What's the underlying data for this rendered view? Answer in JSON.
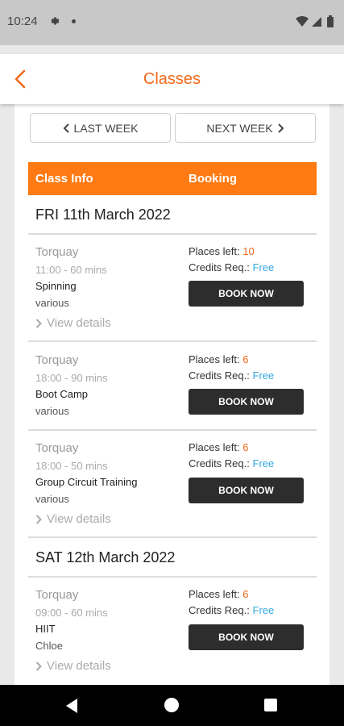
{
  "status_bar": {
    "time": "10:24"
  },
  "header": {
    "title": "Classes"
  },
  "week_nav": {
    "prev_label": "LAST WEEK",
    "next_label": "NEXT WEEK"
  },
  "table_header": {
    "info": "Class Info",
    "booking": "Booking"
  },
  "days": [
    {
      "heading": "FRI 11th March 2022",
      "classes": [
        {
          "location": "Torquay",
          "time": "11:00 - 60 mins",
          "name": "Spinning",
          "instructor": "various",
          "details": "View details",
          "places_label": "Places left:",
          "places": "10",
          "credits_label": "Credits Req.:",
          "credits": "Free",
          "book": "BOOK NOW"
        },
        {
          "location": "Torquay",
          "time": "18:00 - 90 mins",
          "name": "Boot Camp",
          "instructor": "various",
          "details": "",
          "places_label": "Places left:",
          "places": "6",
          "credits_label": "Credits Req.:",
          "credits": "Free",
          "book": "BOOK NOW"
        },
        {
          "location": "Torquay",
          "time": "18:00 - 50 mins",
          "name": "Group Circuit Training",
          "instructor": "various",
          "details": "View details",
          "places_label": "Places left:",
          "places": "6",
          "credits_label": "Credits Req.:",
          "credits": "Free",
          "book": "BOOK NOW"
        }
      ]
    },
    {
      "heading": "SAT 12th March 2022",
      "classes": [
        {
          "location": "Torquay",
          "time": "09:00 - 60 mins",
          "name": "HIIT",
          "instructor": "Chloe",
          "details": "View details",
          "places_label": "Places left:",
          "places": "6",
          "credits_label": "Credits Req.:",
          "credits": "Free",
          "book": "BOOK NOW"
        }
      ]
    }
  ],
  "colors": {
    "accent": "#f26a1b",
    "table_header": "#ff7a12",
    "free": "#35a8e0",
    "button": "#2d2d2d"
  }
}
